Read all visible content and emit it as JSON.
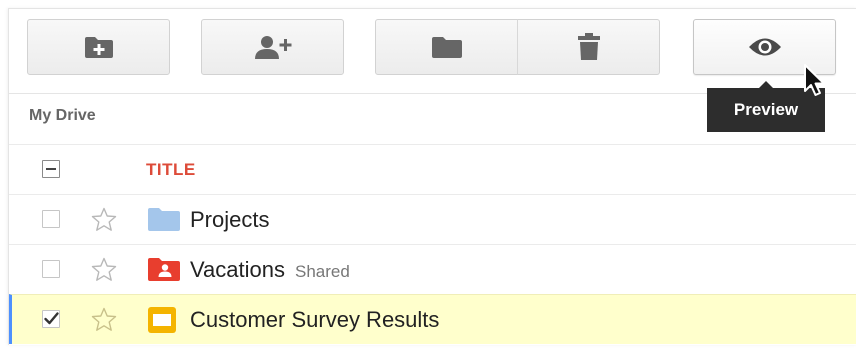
{
  "toolbar": {
    "buttons": [
      {
        "name": "new-folder",
        "icon": "folder-plus-icon"
      },
      {
        "name": "share",
        "icon": "person-add-icon"
      },
      {
        "name": "move-to",
        "icon": "folder-icon"
      },
      {
        "name": "delete",
        "icon": "trash-icon"
      },
      {
        "name": "preview",
        "icon": "eye-icon"
      }
    ],
    "tooltip": "Preview"
  },
  "breadcrumb": "My Drive",
  "list": {
    "header": {
      "title": "TITLE"
    },
    "rows": [
      {
        "name": "Projects",
        "icon": "folder-icon",
        "checked": false,
        "starred": false,
        "shared": ""
      },
      {
        "name": "Vacations",
        "icon": "shared-folder-icon",
        "checked": false,
        "starred": false,
        "shared": "Shared"
      },
      {
        "name": "Customer Survey Results",
        "icon": "presentation-icon",
        "checked": true,
        "starred": false,
        "shared": ""
      }
    ]
  },
  "colors": {
    "title_red": "#dd4b39",
    "folder_blue": "#a4c6eb",
    "shared_folder_red": "#e83e2e",
    "slides_yellow": "#f4b400",
    "selected_row": "#ffffcc",
    "selected_accent": "#4d90fe",
    "tooltip_bg": "#2d2d2d"
  }
}
